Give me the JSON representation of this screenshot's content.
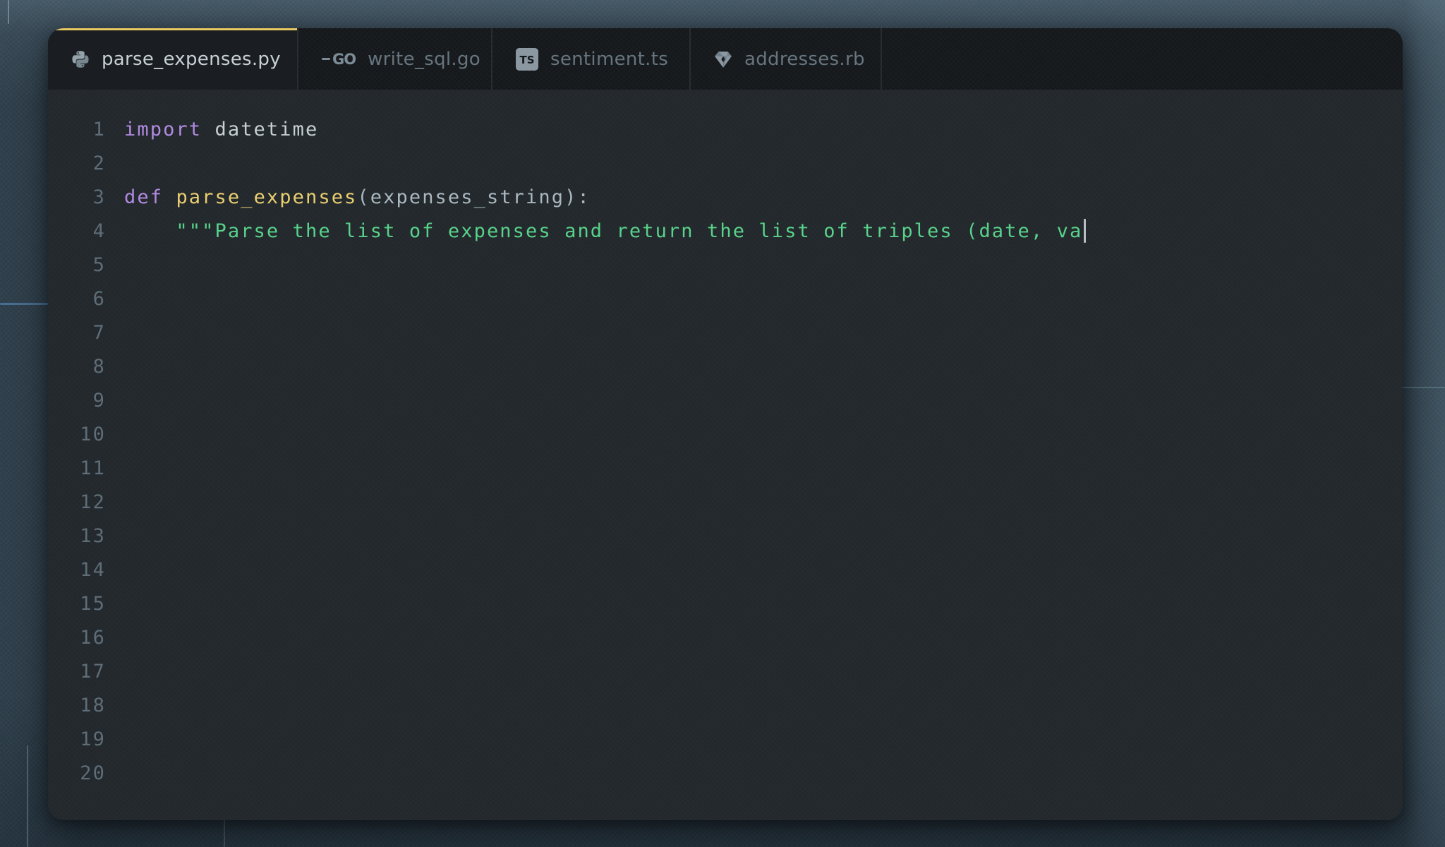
{
  "tabs": [
    {
      "label": "parse_expenses.py",
      "icon": "python-icon",
      "active": true
    },
    {
      "label": "write_sql.go",
      "icon": "go-icon",
      "icon_text": "GO",
      "active": false
    },
    {
      "label": "sentiment.ts",
      "icon": "typescript-icon",
      "icon_text": "TS",
      "active": false
    },
    {
      "label": "addresses.rb",
      "icon": "ruby-icon",
      "active": false
    }
  ],
  "editor": {
    "language": "python",
    "visible_line_count": 20,
    "lines": [
      {
        "n": 1,
        "tokens": [
          {
            "type": "keyword",
            "text": "import"
          },
          {
            "type": "plain",
            "text": " datetime"
          }
        ]
      },
      {
        "n": 2,
        "tokens": []
      },
      {
        "n": 3,
        "tokens": [
          {
            "type": "keyword",
            "text": "def"
          },
          {
            "type": "plain",
            "text": " "
          },
          {
            "type": "function",
            "text": "parse_expenses"
          },
          {
            "type": "punct",
            "text": "(expenses_string):"
          }
        ]
      },
      {
        "n": 4,
        "cursor": true,
        "tokens": [
          {
            "type": "string",
            "text": "    \"\"\"Parse the list of expenses and return the list of triples (date, va"
          }
        ]
      },
      {
        "n": 5,
        "tokens": []
      },
      {
        "n": 6,
        "tokens": []
      },
      {
        "n": 7,
        "tokens": []
      },
      {
        "n": 8,
        "tokens": []
      },
      {
        "n": 9,
        "tokens": []
      },
      {
        "n": 10,
        "tokens": []
      },
      {
        "n": 11,
        "tokens": []
      },
      {
        "n": 12,
        "tokens": []
      },
      {
        "n": 13,
        "tokens": []
      },
      {
        "n": 14,
        "tokens": []
      },
      {
        "n": 15,
        "tokens": []
      },
      {
        "n": 16,
        "tokens": []
      },
      {
        "n": 17,
        "tokens": []
      },
      {
        "n": 18,
        "tokens": []
      },
      {
        "n": 19,
        "tokens": []
      },
      {
        "n": 20,
        "tokens": []
      }
    ]
  },
  "colors": {
    "desktop_bg": "#2e3e4a",
    "editor_bg": "#23282c",
    "tab_bar_bg": "#16191c",
    "active_tab_bg": "#1a1e22",
    "active_tab_accent": "#e8c862",
    "tab_text_active": "#c6d0d5",
    "tab_text_inactive": "#66757f",
    "line_number": "#5e6d77",
    "token_keyword": "#b28ae2",
    "token_function": "#e9cf70",
    "token_string": "#58d28a",
    "token_plain": "#c6cfd4",
    "token_punctuation": "#a9b7bf",
    "cursor": "#b4bec3"
  }
}
